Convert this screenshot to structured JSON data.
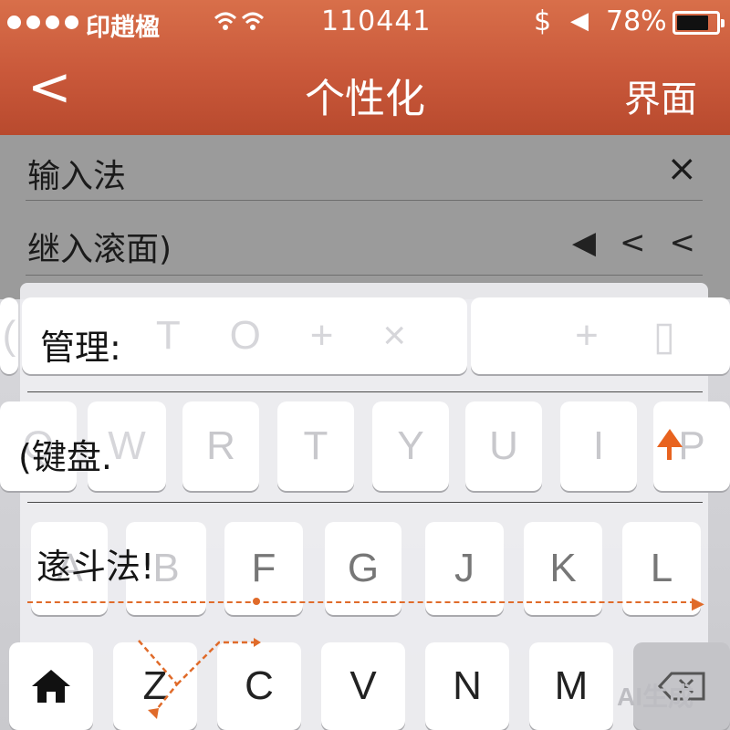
{
  "status_bar": {
    "carrier": "印趙楹",
    "wifi_glyph": "ᯤ",
    "time": "110441",
    "signal_1": "$",
    "signal_2": "◀",
    "battery_percent": "78%",
    "battery_level": 0.78
  },
  "nav": {
    "back_glyph": "<",
    "title": "个性化",
    "right_action": "界面"
  },
  "settings": {
    "rows": [
      {
        "label": "输入法",
        "trailing": "×"
      },
      {
        "label": "继入滚面)",
        "trailing": [
          "◀",
          "<",
          "<"
        ]
      }
    ]
  },
  "keyboard": {
    "row0_ghost": [
      "(",
      "T",
      "O",
      "+",
      "×",
      "+",
      "▯"
    ],
    "row1": [
      "Q",
      "W",
      "R",
      "T",
      "Y",
      "U",
      "I",
      "P"
    ],
    "row2": [
      "A",
      "B",
      "F",
      "G",
      "J",
      "K",
      "L"
    ],
    "row3": [
      "Z",
      "C",
      "V",
      "N",
      "M"
    ],
    "overlay_labels": {
      "manage": "管理:",
      "keyboard": "(键盘.",
      "speed": "逺斗法!"
    },
    "watermark": "AI生成",
    "accent_color": "#e06b2a"
  },
  "icons": {
    "home": "home-icon",
    "backspace": "backspace-icon",
    "shift": "shift-arrow-icon",
    "close": "close-icon"
  }
}
